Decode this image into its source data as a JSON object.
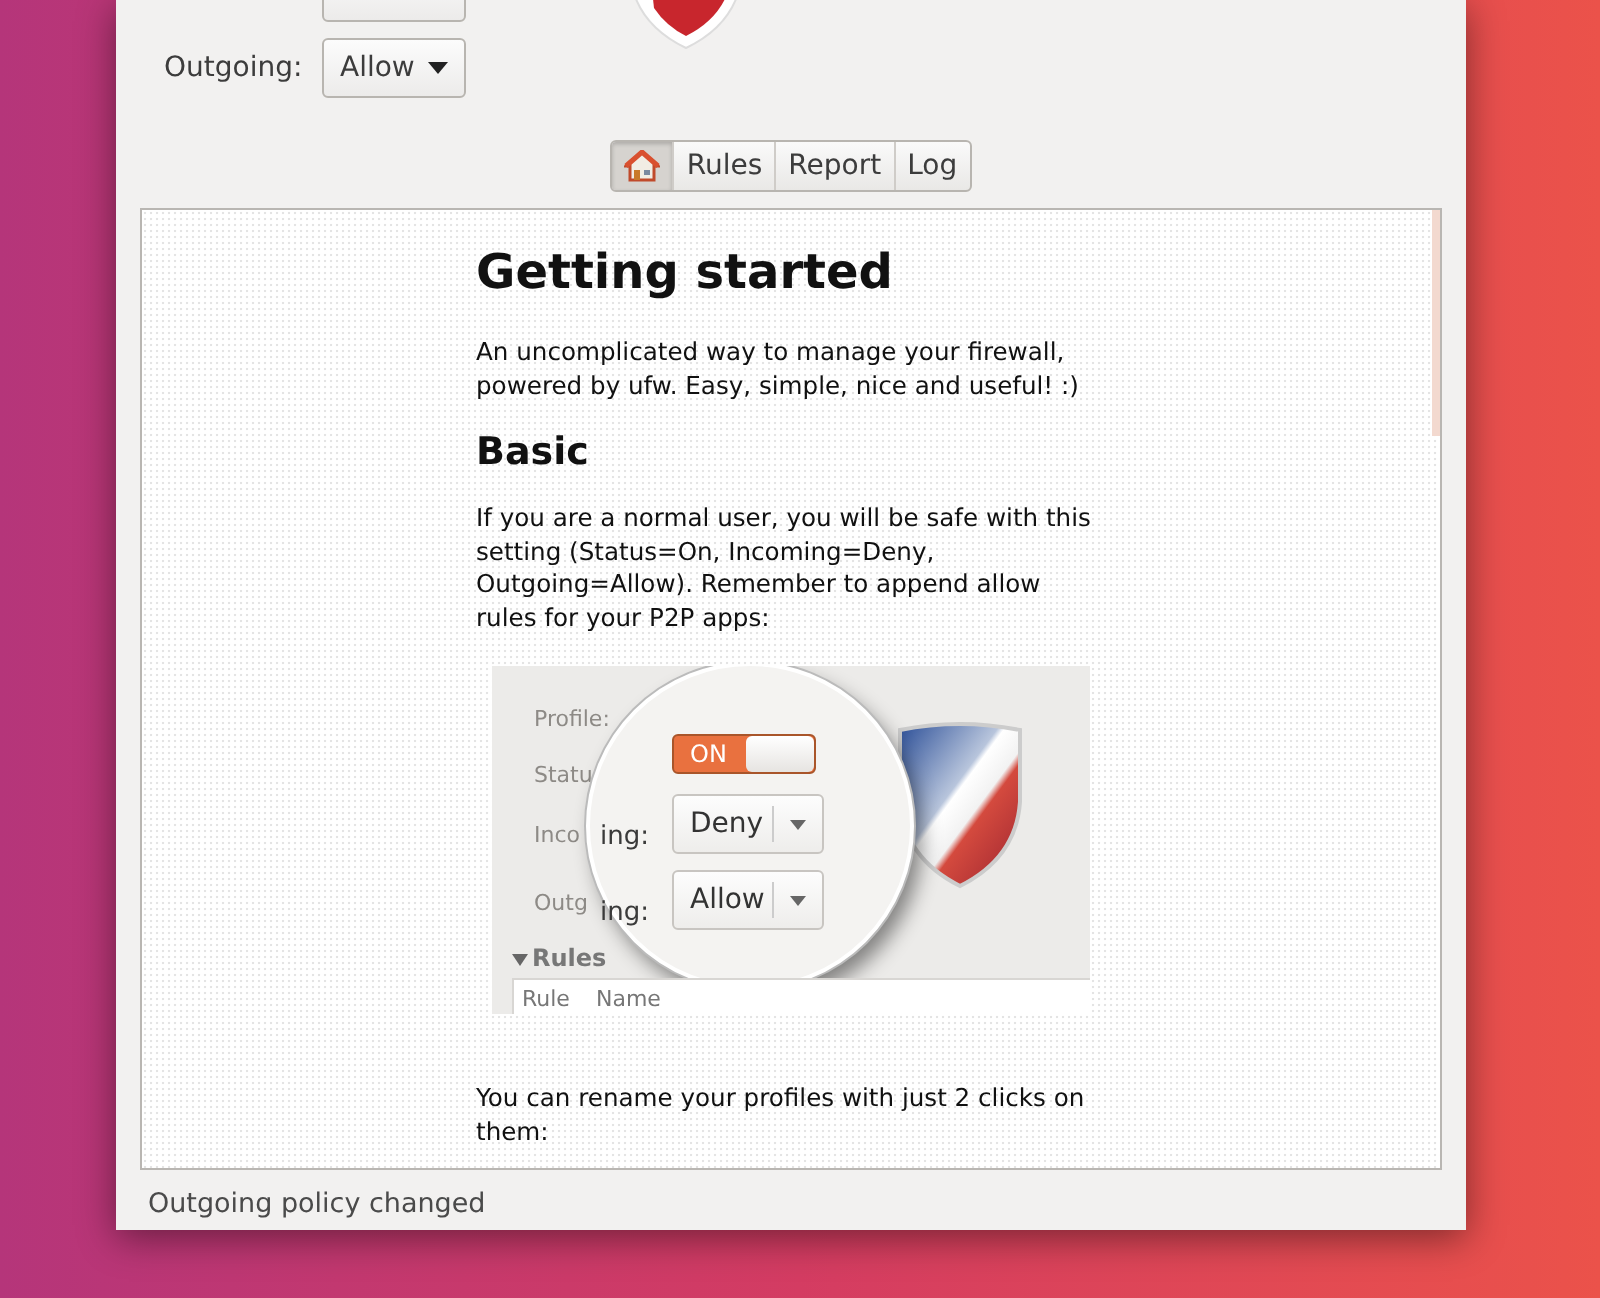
{
  "policies": [
    {
      "label": "Outgoing:",
      "value": "Allow"
    }
  ],
  "tabs": [
    {
      "kind": "icon",
      "selected": true
    },
    {
      "kind": "text",
      "label": "Rules",
      "selected": false
    },
    {
      "kind": "text",
      "label": "Report",
      "selected": false
    },
    {
      "kind": "text",
      "label": "Log",
      "selected": false
    }
  ],
  "document": {
    "blocks": [
      {
        "kind": "h1",
        "text": "Getting started"
      },
      {
        "kind": "p",
        "text": "An uncomplicated way to manage your firewall, powered by ufw. Easy, simple, nice and useful! :)"
      },
      {
        "kind": "h2",
        "text": "Basic"
      },
      {
        "kind": "p",
        "text": "If you are a normal user, you will be safe with this setting (Status=On, Incoming=Deny, Outgoing=Allow). Remember to append allow rules for your P2P apps:"
      },
      {
        "kind": "screenshot",
        "outer_labels": [
          "Profile:",
          "Statu",
          "Inco",
          "Outg"
        ],
        "lens_labels": [
          "ing:",
          "ing:"
        ],
        "toggle": {
          "label": "ON",
          "on": true
        },
        "combos": [
          "Deny",
          "Allow"
        ],
        "section": "Rules",
        "columns": [
          "Rule",
          "Name"
        ]
      },
      {
        "kind": "p",
        "text": "You can rename your profiles with just 2 clicks on them:"
      }
    ]
  },
  "status_bar": {
    "text": "Outgoing policy changed"
  }
}
